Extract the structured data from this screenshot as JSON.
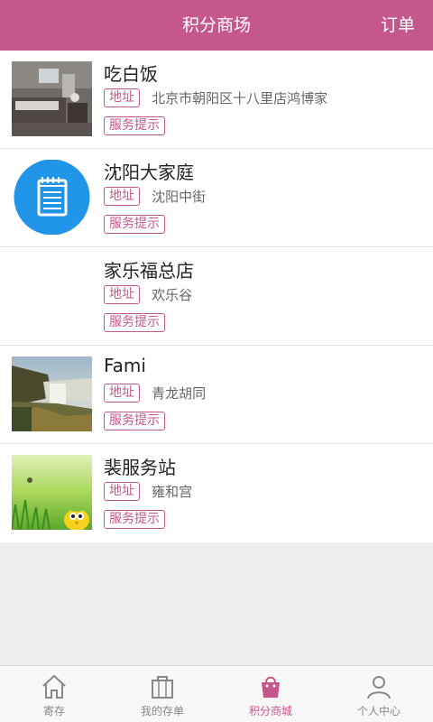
{
  "header": {
    "title": "积分商场",
    "orders": "订单"
  },
  "tags": {
    "address": "地址",
    "service_tip": "服务提示"
  },
  "stores": [
    {
      "name": "吃白饭",
      "address": "北京市朝阳区十八里店鸿博家",
      "thumb": "room-photo"
    },
    {
      "name": "沈阳大家庭",
      "address": "沈阳中街",
      "thumb": "notepad-icon"
    },
    {
      "name": "家乐福总店",
      "address": "欢乐谷",
      "thumb": "none"
    },
    {
      "name": "Fami",
      "address": "青龙胡同",
      "thumb": "waterfall-photo"
    },
    {
      "name": "裴服务站",
      "address": "雍和宫",
      "thumb": "cartoon-bird-photo"
    }
  ],
  "tabs": [
    {
      "label": "寄存",
      "icon": "home-icon",
      "active": false
    },
    {
      "label": "我的存单",
      "icon": "shopping-bag-icon",
      "active": false
    },
    {
      "label": "积分商城",
      "icon": "points-bag-icon",
      "active": true
    },
    {
      "label": "个人中心",
      "icon": "person-icon",
      "active": false
    }
  ],
  "colors": {
    "accent": "#c6578c",
    "blue": "#2196e8"
  }
}
